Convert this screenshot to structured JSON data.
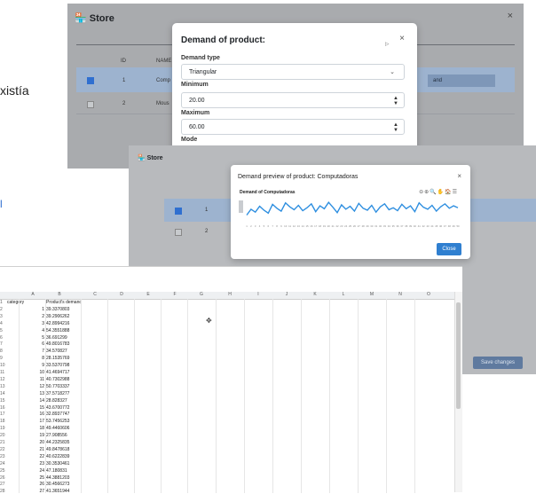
{
  "background": {
    "text": "xistía",
    "link_char": "l"
  },
  "window1": {
    "title": "Store",
    "close": "×",
    "columns": [
      "ID",
      "NAME"
    ],
    "rows": [
      {
        "id": "1",
        "name": "Comp",
        "checked": true
      },
      {
        "id": "2",
        "name": "Mous",
        "checked": false
      }
    ],
    "button_fragment": "and"
  },
  "modal1": {
    "title": "Demand of product:",
    "close": "×",
    "demand_type_label": "Demand type",
    "demand_type_value": "Triangular",
    "minimum_label": "Minimum",
    "minimum_value": "20.00",
    "maximum_label": "Maximum",
    "maximum_value": "60.00",
    "mode_label": "Mode"
  },
  "window2": {
    "title": "Store",
    "rows": [
      {
        "id": "1",
        "checked": true
      },
      {
        "id": "2",
        "checked": false
      }
    ],
    "save_label": "Save changes"
  },
  "modal2": {
    "title": "Demand preview of product: Computadoras",
    "close": "×",
    "chart_title": "Demand of Computadoras",
    "toolbar_icons": "⊖⊕🔍✋🏠☰",
    "close_label": "Close"
  },
  "chart_data": {
    "type": "line",
    "title": "Demand of Computadoras",
    "color": "#2f8fe0",
    "x": [
      1,
      2,
      3,
      4,
      5,
      6,
      7,
      8,
      9,
      10,
      11,
      12,
      13,
      14,
      15,
      16,
      17,
      18,
      19,
      20,
      21,
      22,
      23,
      24,
      25,
      26,
      27,
      28,
      29,
      30,
      31,
      32,
      33,
      34,
      35,
      36,
      37,
      38,
      39,
      40,
      41,
      42,
      43,
      44,
      45,
      46,
      47,
      48,
      49,
      50
    ],
    "values": [
      30,
      42,
      36,
      48,
      40,
      34,
      52,
      44,
      38,
      55,
      47,
      41,
      50,
      39,
      45,
      53,
      37,
      49,
      43,
      56,
      46,
      35,
      51,
      42,
      48,
      38,
      54,
      44,
      40,
      50,
      36,
      47,
      53,
      41,
      45,
      39,
      52,
      43,
      49,
      37,
      55,
      46,
      42,
      50,
      38,
      47,
      53,
      44,
      49,
      45
    ],
    "ylim": [
      20,
      60
    ]
  },
  "sheet": {
    "columns": [
      "A",
      "B",
      "C",
      "D",
      "E",
      "F",
      "G",
      "H",
      "I",
      "J",
      "K",
      "L",
      "M",
      "N",
      "O"
    ],
    "header": {
      "category": "category",
      "demand": "Product's demand"
    },
    "rows": [
      [
        "1",
        "39.3370803"
      ],
      [
        "2",
        "39.2906262"
      ],
      [
        "3",
        "42.8994216"
      ],
      [
        "4",
        "54.3551888"
      ],
      [
        "5",
        "36.691299"
      ],
      [
        "6",
        "49.8016783"
      ],
      [
        "7",
        "34.570827"
      ],
      [
        "8",
        "28.1535769"
      ],
      [
        "9",
        "33.5370798"
      ],
      [
        "10",
        "41.4694717"
      ],
      [
        "11",
        "40.7302988"
      ],
      [
        "12",
        "50.7703337"
      ],
      [
        "13",
        "37.5718277"
      ],
      [
        "14",
        "28.828327"
      ],
      [
        "15",
        "43.6700772"
      ],
      [
        "16",
        "32.8937747"
      ],
      [
        "17",
        "53.7456253"
      ],
      [
        "18",
        "49.4460606"
      ],
      [
        "19",
        "27.908556"
      ],
      [
        "20",
        "44.2325835"
      ],
      [
        "21",
        "49.8478618"
      ],
      [
        "22",
        "40.6222839"
      ],
      [
        "23",
        "30.3530461"
      ],
      [
        "24",
        "47.180831"
      ],
      [
        "25",
        "44.3881203"
      ],
      [
        "26",
        "30.4566273"
      ],
      [
        "27",
        "41.3651944"
      ]
    ]
  }
}
